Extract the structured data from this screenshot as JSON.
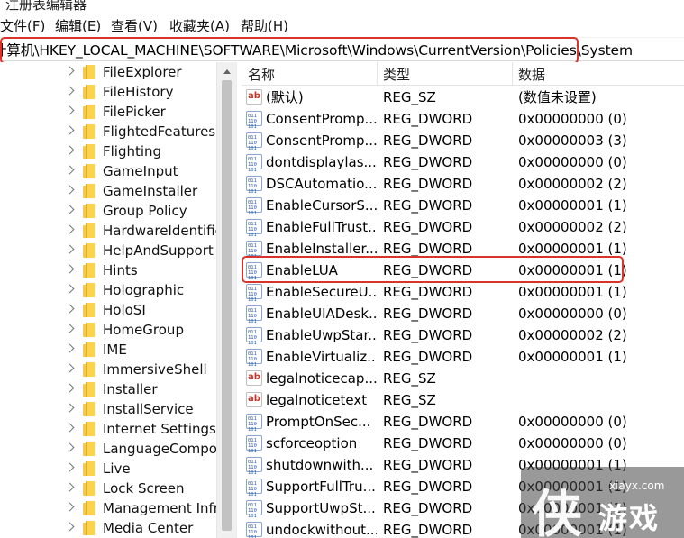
{
  "window": {
    "title": "注册表编辑器"
  },
  "menu": [
    "文件(F)",
    "编辑(E)",
    "查看(V)",
    "收藏夹(A)",
    "帮助(H)"
  ],
  "address": {
    "path": "计算机\\HKEY_LOCAL_MACHINE\\SOFTWARE\\Microsoft\\Windows\\CurrentVersion\\Policies\\System"
  },
  "tree": {
    "items": [
      "FileExplorer",
      "FileHistory",
      "FilePicker",
      "FlightedFeatures",
      "Flighting",
      "GameInput",
      "GameInstaller",
      "Group Policy",
      "HardwareIdentific",
      "HelpAndSupport",
      "Hints",
      "Holographic",
      "HoloSI",
      "HomeGroup",
      "IME",
      "ImmersiveShell",
      "Installer",
      "InstallService",
      "Internet Settings",
      "LanguageCompo",
      "Live",
      "Lock Screen",
      "Management Infr",
      "Media Center"
    ]
  },
  "list": {
    "headers": {
      "name": "名称",
      "type": "类型",
      "data": "数据"
    },
    "rows": [
      {
        "icon": "string-value-icon",
        "name": "(默认)",
        "type": "REG_SZ",
        "data": "(数值未设置)"
      },
      {
        "icon": "dword-value-icon",
        "name": "ConsentPromp...",
        "type": "REG_DWORD",
        "data": "0x00000000 (0)"
      },
      {
        "icon": "dword-value-icon",
        "name": "ConsentPromp...",
        "type": "REG_DWORD",
        "data": "0x00000003 (3)"
      },
      {
        "icon": "dword-value-icon",
        "name": "dontdisplaylas...",
        "type": "REG_DWORD",
        "data": "0x00000000 (0)"
      },
      {
        "icon": "dword-value-icon",
        "name": "DSCAutomatio...",
        "type": "REG_DWORD",
        "data": "0x00000002 (2)"
      },
      {
        "icon": "dword-value-icon",
        "name": "EnableCursorS...",
        "type": "REG_DWORD",
        "data": "0x00000001 (1)"
      },
      {
        "icon": "dword-value-icon",
        "name": "EnableFullTrust...",
        "type": "REG_DWORD",
        "data": "0x00000002 (2)"
      },
      {
        "icon": "dword-value-icon",
        "name": "EnableInstaller...",
        "type": "REG_DWORD",
        "data": "0x00000001 (1)"
      },
      {
        "icon": "dword-value-icon",
        "name": "EnableLUA",
        "type": "REG_DWORD",
        "data": "0x00000001 (1)"
      },
      {
        "icon": "dword-value-icon",
        "name": "EnableSecureU...",
        "type": "REG_DWORD",
        "data": "0x00000001 (1)"
      },
      {
        "icon": "dword-value-icon",
        "name": "EnableUIADesk...",
        "type": "REG_DWORD",
        "data": "0x00000000 (0)"
      },
      {
        "icon": "dword-value-icon",
        "name": "EnableUwpStar...",
        "type": "REG_DWORD",
        "data": "0x00000002 (2)"
      },
      {
        "icon": "dword-value-icon",
        "name": "EnableVirtualiz...",
        "type": "REG_DWORD",
        "data": "0x00000001 (1)"
      },
      {
        "icon": "string-value-icon",
        "name": "legalnoticecap...",
        "type": "REG_SZ",
        "data": ""
      },
      {
        "icon": "string-value-icon",
        "name": "legalnoticetext",
        "type": "REG_SZ",
        "data": ""
      },
      {
        "icon": "dword-value-icon",
        "name": "PromptOnSec...",
        "type": "REG_DWORD",
        "data": "0x00000000 (0)"
      },
      {
        "icon": "dword-value-icon",
        "name": "scforceoption",
        "type": "REG_DWORD",
        "data": "0x00000000 (0)"
      },
      {
        "icon": "dword-value-icon",
        "name": "shutdownwith...",
        "type": "REG_DWORD",
        "data": "0x00000001 (1)"
      },
      {
        "icon": "dword-value-icon",
        "name": "SupportFullTru...",
        "type": "REG_DWORD",
        "data": "0x00000001 (1)"
      },
      {
        "icon": "dword-value-icon",
        "name": "SupportUwpSt...",
        "type": "REG_DWORD",
        "data": "0x00000001 (1)"
      },
      {
        "icon": "dword-value-icon",
        "name": "undockwithout...",
        "type": "REG_DWORD",
        "data": "0x00000001 (1)"
      }
    ]
  },
  "watermark": {
    "glyph": "侠",
    "domain": "xiayx.com",
    "name": "游戏"
  },
  "colors": {
    "highlight": "#d9342b",
    "folder": "#f7c948",
    "dword_icon": "#2a5db0",
    "string_icon": "#c0392b"
  }
}
